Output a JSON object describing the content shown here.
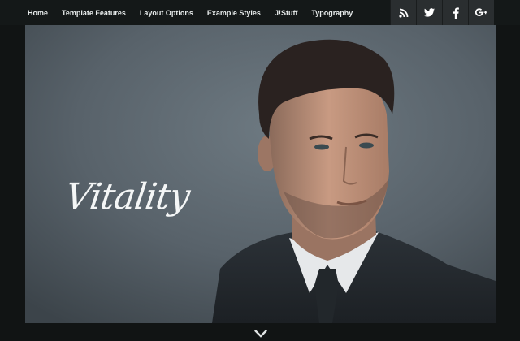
{
  "nav": {
    "items": [
      "Home",
      "Template Features",
      "Layout Options",
      "Example Styles",
      "J!Stuff",
      "Typography"
    ]
  },
  "social": {
    "icons": [
      "rss-icon",
      "twitter-icon",
      "facebook-icon",
      "google-plus-icon"
    ]
  },
  "hero": {
    "logo_text": "Vitality"
  },
  "colors": {
    "background": "#111414",
    "topbar": "#141818",
    "social_button": "#2a2e30",
    "hero_backdrop": "#566068",
    "text": "#e8ecec"
  }
}
